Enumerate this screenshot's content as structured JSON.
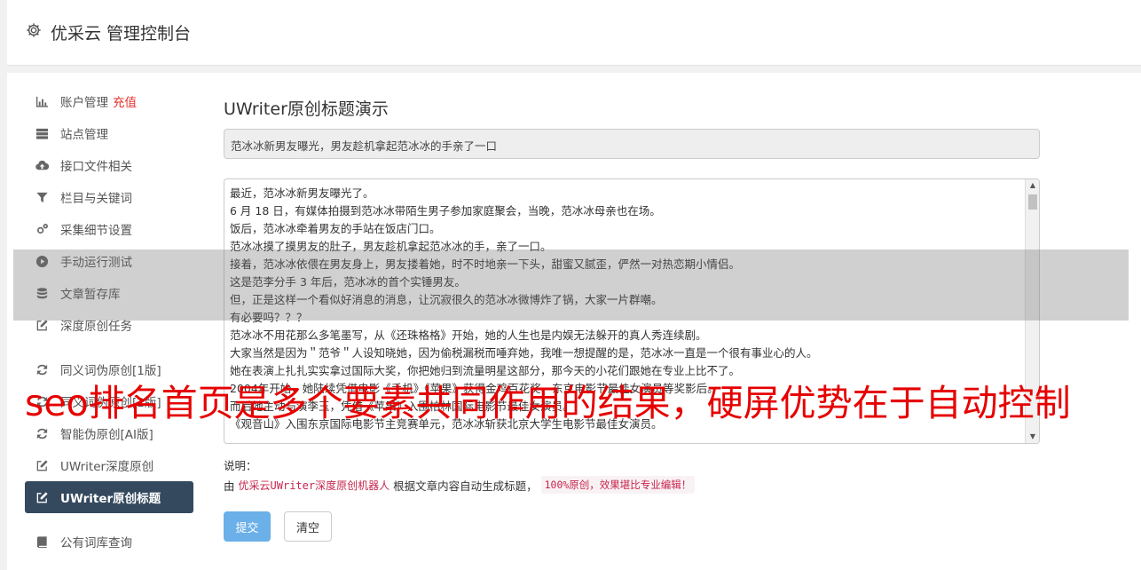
{
  "header": {
    "brand": "优采云 管理控制台",
    "icon": "gear-icon"
  },
  "sidebar": {
    "groups": [
      [
        {
          "label": "账户管理",
          "badge": "充值",
          "icon": "bar-chart-icon"
        },
        {
          "label": "站点管理",
          "icon": "server-icon"
        },
        {
          "label": "接口文件相关",
          "icon": "cloud-upload-icon"
        },
        {
          "label": "栏目与关键词",
          "icon": "filter-icon"
        },
        {
          "label": "采集细节设置",
          "icon": "gears-icon"
        },
        {
          "label": "手动运行测试",
          "icon": "play-circle-icon"
        },
        {
          "label": "文章暂存库",
          "icon": "database-icon"
        },
        {
          "label": "深度原创任务",
          "icon": "edit-icon"
        }
      ],
      [
        {
          "label": "同义词伪原创[1版]",
          "icon": "refresh-icon"
        },
        {
          "label": "同义词伪原创[2版]",
          "icon": "refresh-icon"
        },
        {
          "label": "智能伪原创[AI版]",
          "icon": "refresh-icon"
        },
        {
          "label": "UWriter深度原创",
          "icon": "edit-icon"
        },
        {
          "label": "UWriter原创标题",
          "icon": "edit-icon",
          "active": true
        }
      ],
      [
        {
          "label": "公有词库查询",
          "icon": "book-icon"
        }
      ]
    ]
  },
  "main": {
    "title": "UWriter原创标题演示",
    "title_value": "范冰冰新男友曝光，男友趁机拿起范冰冰的手亲了一口",
    "article_lines": [
      "最近，范冰冰新男友曝光了。",
      "6 月 18 日，有媒体拍摄到范冰冰带陌生男子参加家庭聚会，当晚，范冰冰母亲也在场。",
      "饭后，范冰冰牵着男友的手站在饭店门口。",
      "范冰冰摸了摸男友的肚子，男友趁机拿起范冰冰的手，亲了一口。",
      "接着，范冰冰依偎在男友身上，男友搂着她，时不时地亲一下头，甜蜜又腻歪，俨然一对热恋期小情侣。",
      "这是范李分手 3 年后，范冰冰的首个实锤男友。",
      "但，正是这样一个看似好消息的消息，让沉寂很久的范冰冰微博炸了锅，大家一片群嘲。",
      "有必要吗？？？",
      "范冰冰不用花那么多笔墨写，从《还珠格格》开始，她的人生也是内娱无法躲开的真人秀连续剧。",
      "大家当然是因为＂范爷＂人设知晓她，因为偷税漏税而唾弃她，我唯一想提醒的是，范冰冰一直是一个很有事业心的人。",
      "她在表演上扎扎实实拿过国际大奖，你把她归到流量明星这部分，那今天的小花们跟她在专业上比不了。",
      "2004年开始，她陆续凭借电影《手机》《苹果》获得金鸡百花奖、东京电影节最佳女演员等奖影后。",
      "而后她主动与演李玉，凭借《苹果》入围柏林国际电影节最佳女演员。",
      "《观音山》入围东京国际电影节主竞赛单元，范冰冰斩获北京大学生电影节最佳女演员。"
    ],
    "note_label": "说明：",
    "note_prefix": "由",
    "note_link": "优采云UWriter深度原创机器人",
    "note_middle": "根据文章内容自动生成标题，",
    "note_code": "100%原创，效果堪比专业编辑！",
    "submit_label": "提交",
    "clear_label": "清空"
  },
  "overlay": {
    "caption": "seo排名首页是多个要素共同作用的结果，硬屏优势在于自动控制"
  }
}
